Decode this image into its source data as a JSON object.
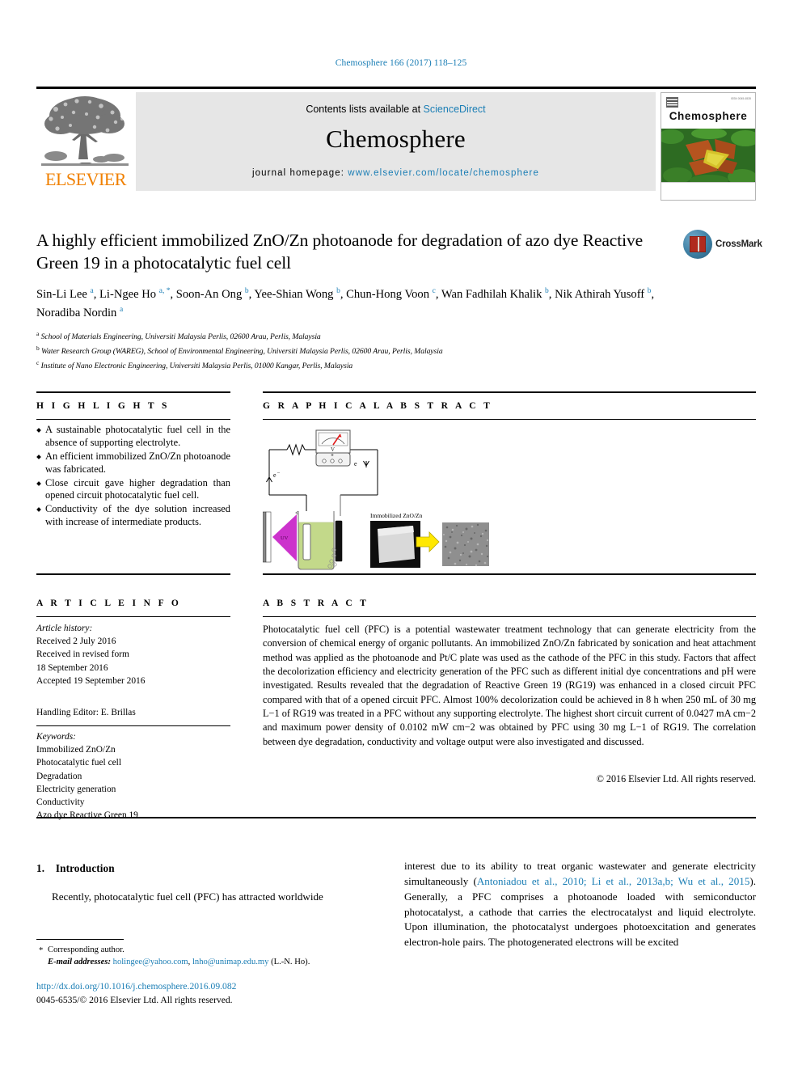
{
  "running_head": "Chemosphere 166 (2017) 118–125",
  "masthead": {
    "contents_prefix": "Contents lists available at ",
    "sciencedirect": "ScienceDirect",
    "journal_name": "Chemosphere",
    "homepage_label": "journal homepage:",
    "homepage_url": "www.elsevier.com/locate/chemosphere",
    "publisher_logo_text": "ELSEVIER",
    "cover_journal_name": "Chemosphere",
    "cover_issn_text": "ISSN 0045-6535",
    "accent_blue": "#1b7eb5",
    "elsevier_orange": "#f08000"
  },
  "article": {
    "title": "A highly efficient immobilized ZnO/Zn photoanode for degradation of azo dye Reactive Green 19 in a photocatalytic fuel cell",
    "crossmark_label": "CrossMark",
    "authors": [
      {
        "name": "Sin-Li Lee",
        "marks": "a",
        "star": false,
        "sep": ", "
      },
      {
        "name": "Li-Ngee Ho",
        "marks": "a",
        "star": true,
        "sep": ", "
      },
      {
        "name": "Soon-An Ong",
        "marks": "b",
        "star": false,
        "sep": ", "
      },
      {
        "name": "Yee-Shian Wong",
        "marks": "b",
        "star": false,
        "sep": ", "
      },
      {
        "name": "Chun-Hong Voon",
        "marks": "c",
        "star": false,
        "sep": ", "
      },
      {
        "name": "Wan Fadhilah Khalik",
        "marks": "b",
        "star": false,
        "sep": ", "
      },
      {
        "name": "Nik Athirah Yusoff",
        "marks": "b",
        "star": false,
        "sep": ", "
      },
      {
        "name": "Noradiba Nordin",
        "marks": "a",
        "star": false,
        "sep": ""
      }
    ],
    "affiliations": [
      {
        "mark": "a",
        "text": "School of Materials Engineering, Universiti Malaysia Perlis, 02600 Arau, Perlis, Malaysia"
      },
      {
        "mark": "b",
        "text": "Water Research Group (WAREG), School of Environmental Engineering, Universiti Malaysia Perlis, 02600 Arau, Perlis, Malaysia"
      },
      {
        "mark": "c",
        "text": "Institute of Nano Electronic Engineering, Universiti Malaysia Perlis, 01000 Kangar, Perlis, Malaysia"
      }
    ]
  },
  "highlights": {
    "heading": "H I G H L I G H T S",
    "items": [
      "A sustainable photocatalytic fuel cell in the absence of supporting electrolyte.",
      "An efficient immobilized ZnO/Zn photoanode was fabricated.",
      "Close circuit gave higher degradation than opened circuit photocatalytic fuel cell.",
      "Conductivity of the dye solution increased with increase of intermediate products."
    ]
  },
  "article_info": {
    "heading": "A R T I C L E  I N F O",
    "history_label": "Article history:",
    "history_lines": [
      "Received 2 July 2016",
      "Received in revised form",
      "18 September 2016",
      "Accepted 19 September 2016"
    ],
    "handling_editor": "Handling Editor: E. Brillas",
    "keywords_label": "Keywords:",
    "keywords": [
      "Immobilized ZnO/Zn",
      "Photocatalytic fuel cell",
      "Degradation",
      "Electricity generation",
      "Conductivity",
      "Azo dye Reactive Green 19"
    ]
  },
  "graphical_abstract": {
    "heading": "G R A P H I C A L  A B S T R A C T",
    "labels": {
      "electron_left": "e−",
      "electron_right": "e",
      "meter_symbol": "V",
      "uv_label": "UV",
      "sample_caption": "Immobilized ZnO/Zn"
    },
    "colors": {
      "uv_cone": "#cc33cc",
      "dye_solution": "#c3d98a",
      "arrow": "#ffe800"
    }
  },
  "abstract": {
    "heading": "A B S T R A C T",
    "paragraphs": [
      "Photocatalytic fuel cell (PFC) is a potential wastewater treatment technology that can generate electricity from the conversion of chemical energy of organic pollutants. An immobilized ZnO/Zn fabricated by sonication and heat attachment method was applied as the photoanode and Pt/C plate was used as the cathode of the PFC in this study. Factors that affect the decolorization efficiency and electricity generation of the PFC such as different initial dye concentrations and pH were investigated. Results revealed that the degradation of Reactive Green 19 (RG19) was enhanced in a closed circuit PFC compared with that of a opened circuit PFC. Almost 100% decolorization could be achieved in 8 h when 250 mL of 30 mg L−1 of RG19 was treated in a PFC without any supporting electrolyte. The highest short circuit current of 0.0427 mA cm−2 and maximum power density of 0.0102 mW cm−2 was obtained by PFC using 30 mg L−1 of RG19. The correlation between dye degradation, conductivity and voltage output were also investigated and discussed."
    ],
    "copyright": "© 2016 Elsevier Ltd. All rights reserved."
  },
  "body": {
    "section_number": "1.",
    "section_title": "Introduction",
    "left_paragraph": "Recently, photocatalytic fuel cell (PFC) has attracted worldwide",
    "right_paragraph_pre": "interest due to its ability to treat organic wastewater and generate electricity simultaneously (",
    "right_citations_1": "Antoniadou et al., 2010; Li et al., 2013a,b; Wu et al., 2015",
    "right_paragraph_post": "). Generally, a PFC comprises a photoanode loaded with semiconductor photocatalyst, a cathode that carries the electrocatalyst and liquid electrolyte. Upon illumination, the photocatalyst undergoes photoexcitation and generates electron-hole pairs. The photogenerated electrons will be excited"
  },
  "footer": {
    "corresponding_star": "*",
    "corresponding_label": "Corresponding author.",
    "email_label": "E-mail addresses:",
    "email_1": "holingee@yahoo.com",
    "email_sep": ", ",
    "email_2": "lnho@unimap.edu.my",
    "email_suffix": " (L.-N. Ho).",
    "doi": "http://dx.doi.org/10.1016/j.chemosphere.2016.09.082",
    "issn_line": "0045-6535/© 2016 Elsevier Ltd. All rights reserved."
  }
}
